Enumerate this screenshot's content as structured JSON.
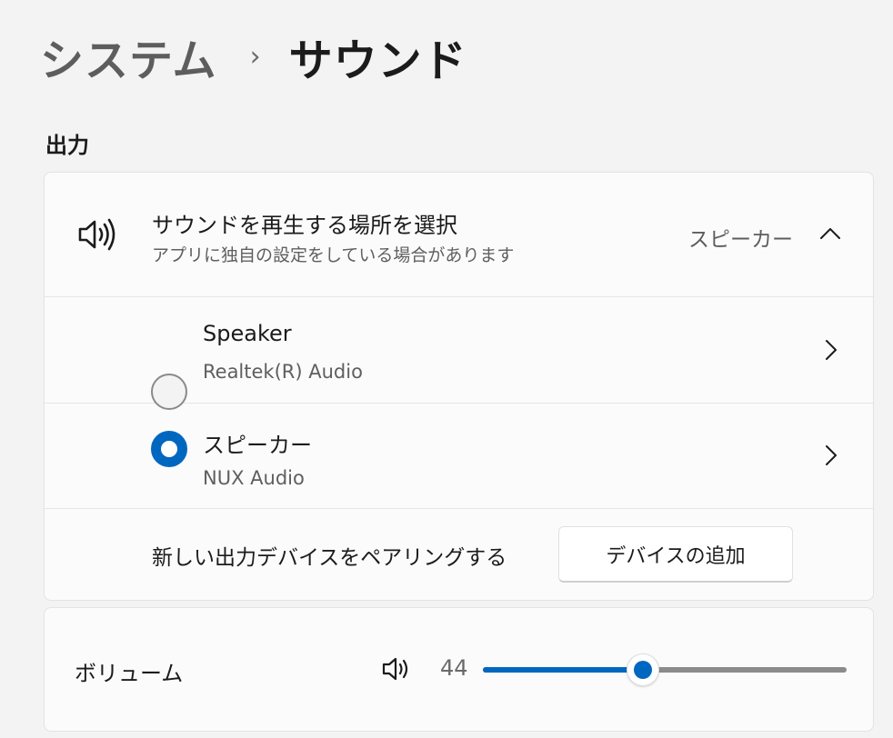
{
  "breadcrumb": {
    "parent": "システム",
    "separator": "›",
    "current": "サウンド"
  },
  "output": {
    "section_title": "出力",
    "selector": {
      "icon": "speaker-icon",
      "title": "サウンドを再生する場所を選択",
      "subtitle": "アプリに独自の設定をしている場合があります",
      "value": "スピーカー",
      "expanded": true
    },
    "devices": [
      {
        "name": "Speaker",
        "sub": "Realtek(R) Audio",
        "selected": false
      },
      {
        "name": "スピーカー",
        "sub": "NUX Audio",
        "selected": true
      }
    ],
    "pair": {
      "label": "新しい出力デバイスをペアリングする",
      "button_label": "デバイスの追加"
    }
  },
  "volume": {
    "label": "ボリューム",
    "icon": "speaker-icon",
    "value": "44",
    "level": 0.44
  },
  "colors": {
    "accent": "#0067c0",
    "background": "#f3f3f3",
    "card": "#fbfbfb"
  }
}
